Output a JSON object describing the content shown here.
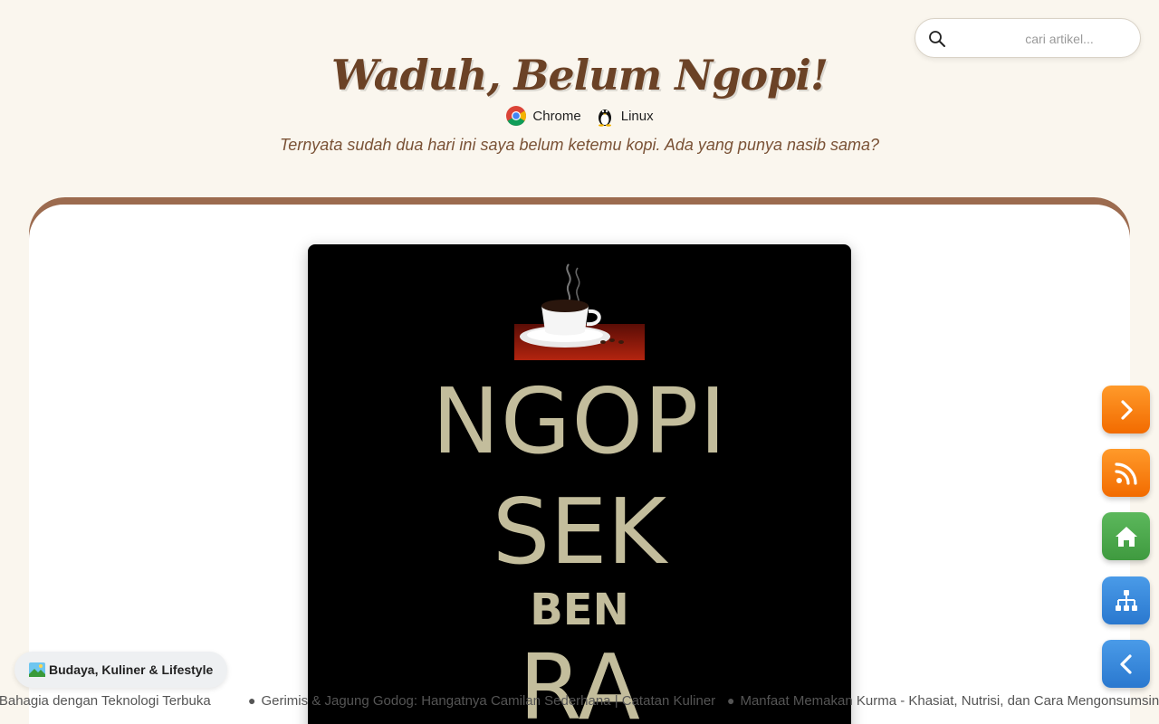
{
  "header": {
    "title": "Waduh, Belum Ngopi!",
    "platforms": [
      {
        "label": "Chrome",
        "icon": "chrome-icon"
      },
      {
        "label": "Linux",
        "icon": "linux-tux-icon"
      }
    ],
    "tagline": "Ternyata sudah dua hari ini saya belum ketemu kopi. Ada yang punya nasib sama?"
  },
  "search": {
    "placeholder": "cari artikel..."
  },
  "poster": {
    "lines": [
      "NGOPI",
      "SEK",
      "BEN",
      "RA"
    ],
    "text_color": "#c3bd9c",
    "background": "#000000"
  },
  "side_buttons": [
    {
      "name": "next",
      "icon": "chevron-right-icon",
      "color": "#f57c00"
    },
    {
      "name": "rss",
      "icon": "rss-icon",
      "color": "#f57c00"
    },
    {
      "name": "home",
      "icon": "home-icon",
      "color": "#4caf50"
    },
    {
      "name": "sitemap",
      "icon": "sitemap-icon",
      "color": "#2f80d8"
    },
    {
      "name": "previous",
      "icon": "chevron-left-icon",
      "color": "#2f80d8"
    }
  ],
  "category": {
    "label": "Budaya, Kuliner & Lifestyle",
    "icon": "landscape-picture-icon"
  },
  "ticker": {
    "items": [
      "up Bahagia dengan Teknologi Terbuka",
      "Gerimis & Jagung Godog: Hangatnya Camilan Sederhana | Catatan Kuliner",
      "Manfaat Memakan Kurma - Khasiat, Nutrisi, dan Cara Mengonsumsinya"
    ]
  },
  "colors": {
    "page_bg": "#faf6ee",
    "title": "#6b4226",
    "card_border": "#9c6b4f"
  }
}
